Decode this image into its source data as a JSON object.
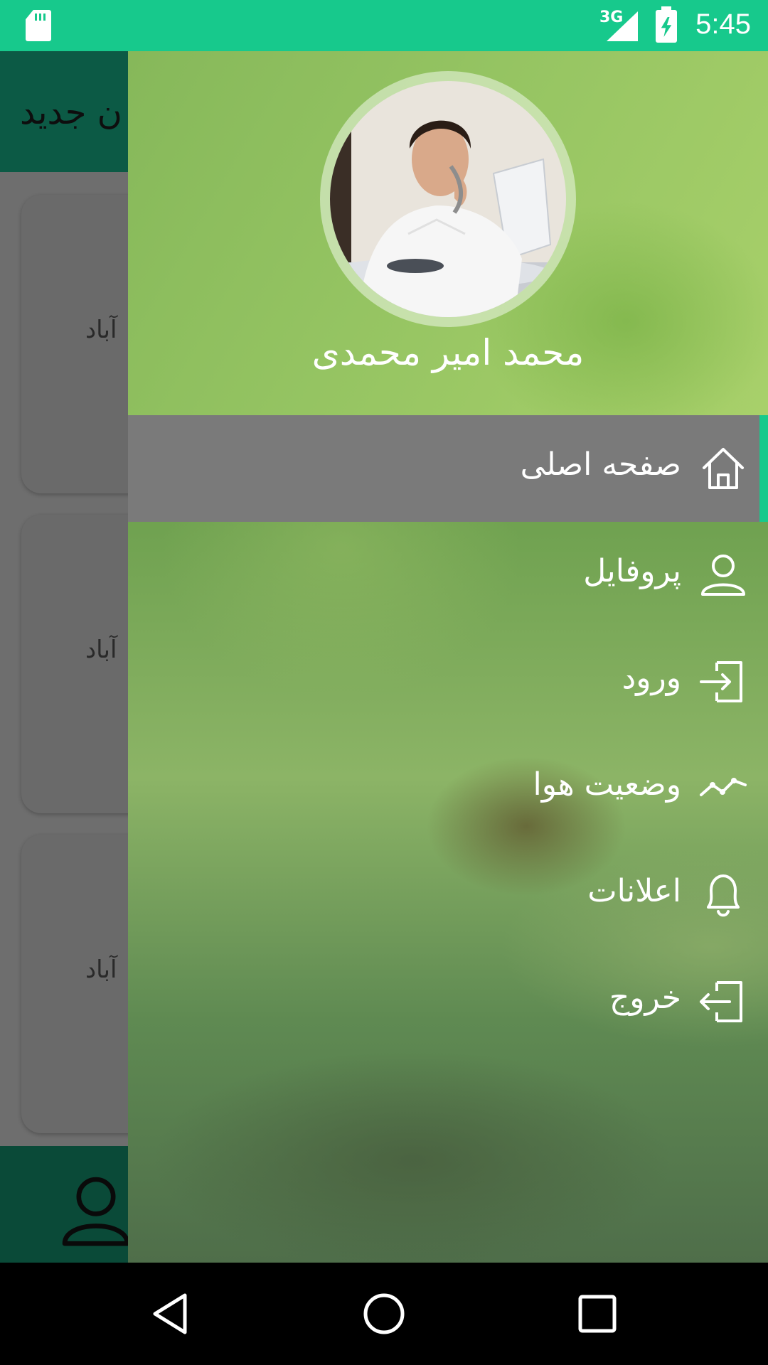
{
  "status_bar": {
    "network": "3G",
    "time": "5:45",
    "color": "#17c98c"
  },
  "app": {
    "title": "ن جدید",
    "cards": [
      {
        "text": "آباد"
      },
      {
        "text": "آباد"
      },
      {
        "text": "آباد"
      }
    ]
  },
  "drawer": {
    "user_name": "محمد امیر محمدی",
    "menu": [
      {
        "label": "صفحه اصلی",
        "icon": "home-icon",
        "active": true
      },
      {
        "label": "پروفایل",
        "icon": "user-icon",
        "active": false
      },
      {
        "label": "ورود",
        "icon": "login-icon",
        "active": false
      },
      {
        "label": "وضعیت هوا",
        "icon": "weather-trend-icon",
        "active": false
      },
      {
        "label": "اعلانات",
        "icon": "bell-icon",
        "active": false
      },
      {
        "label": "خروج",
        "icon": "logout-icon",
        "active": false
      }
    ],
    "accent": "#17c98c"
  },
  "nav": {
    "back": "back-icon",
    "home": "home-circle-icon",
    "recents": "recents-icon"
  }
}
